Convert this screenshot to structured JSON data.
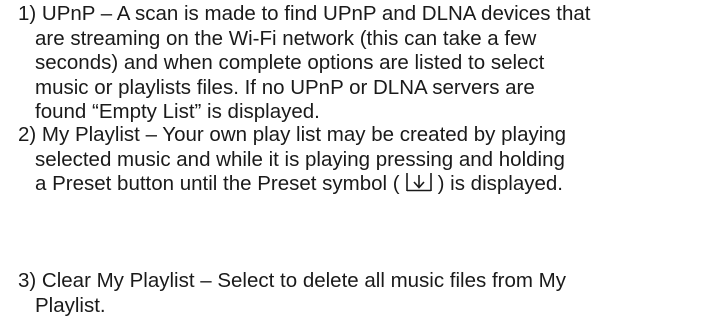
{
  "items": [
    {
      "lines": [
        "1) UPnP – A scan is made to find UPnP and DLNA devices that",
        "are streaming on the Wi-Fi network (this can take a few",
        "seconds) and when complete options are listed to select",
        "music or playlists files. If no UPnP or DLNA servers are",
        "found “Empty List” is displayed."
      ]
    },
    {
      "lines": [
        "2)  My Playlist – Your own play list may be created by playing",
        "selected music and while it is playing pressing and holding"
      ],
      "last_line_before": "a Preset button until the Preset symbol (",
      "last_line_after": ") is displayed.",
      "symbol_icon": "preset-download-icon"
    },
    {
      "lines": [
        "3) Clear My Playlist – Select to delete all music files from My",
        "Playlist."
      ]
    }
  ]
}
